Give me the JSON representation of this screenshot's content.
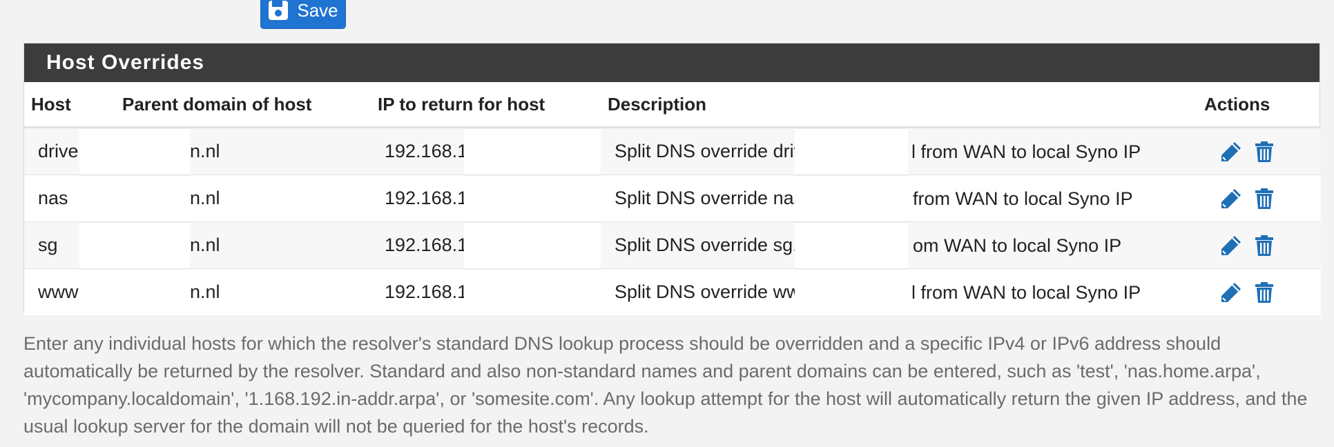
{
  "toolbar": {
    "save_label": "Save",
    "accent_color": "#1f73d1"
  },
  "panel": {
    "title": "Host Overrides",
    "header_color": "#3c3c3c"
  },
  "table": {
    "columns": [
      {
        "label": "Host"
      },
      {
        "label": "Parent domain of host"
      },
      {
        "label": "IP to return for host"
      },
      {
        "label": "Description"
      },
      {
        "label": "Actions"
      }
    ],
    "rows": [
      {
        "host": "drive",
        "domain": "n.nl",
        "ip": "192.168.1",
        "desc_start": "Split DNS override driv",
        "desc_end": "l from WAN to local Syno IP"
      },
      {
        "host": "nas",
        "domain": "n.nl",
        "ip": "192.168.1",
        "desc_start": "Split DNS override nas",
        "desc_end": "from WAN to local Syno IP"
      },
      {
        "host": "sg",
        "domain": "n.nl",
        "ip": "192.168.1",
        "desc_start": "Split DNS override sg.",
        "desc_end": "om WAN to local Syno IP"
      },
      {
        "host": "www",
        "domain": "n.nl",
        "ip": "192.168.1",
        "desc_start": "Split DNS override ww",
        "desc_end": "l from WAN to local Syno IP"
      }
    ],
    "action_icons": [
      "pencil-icon",
      "trash-icon"
    ],
    "icon_color": "#1f6fb5"
  },
  "help": {
    "text": "Enter any individual hosts for which the resolver's standard DNS lookup process should be overridden and a specific IPv4 or IPv6 address should automatically be returned by the resolver. Standard and also non-standard names and parent domains can be entered, such as 'test', 'nas.home.arpa', 'mycompany.localdomain', '1.168.192.in-addr.arpa', or 'somesite.com'. Any lookup attempt for the host will automatically return the given IP address, and the usual lookup server for the domain will not be queried for the host's records."
  }
}
